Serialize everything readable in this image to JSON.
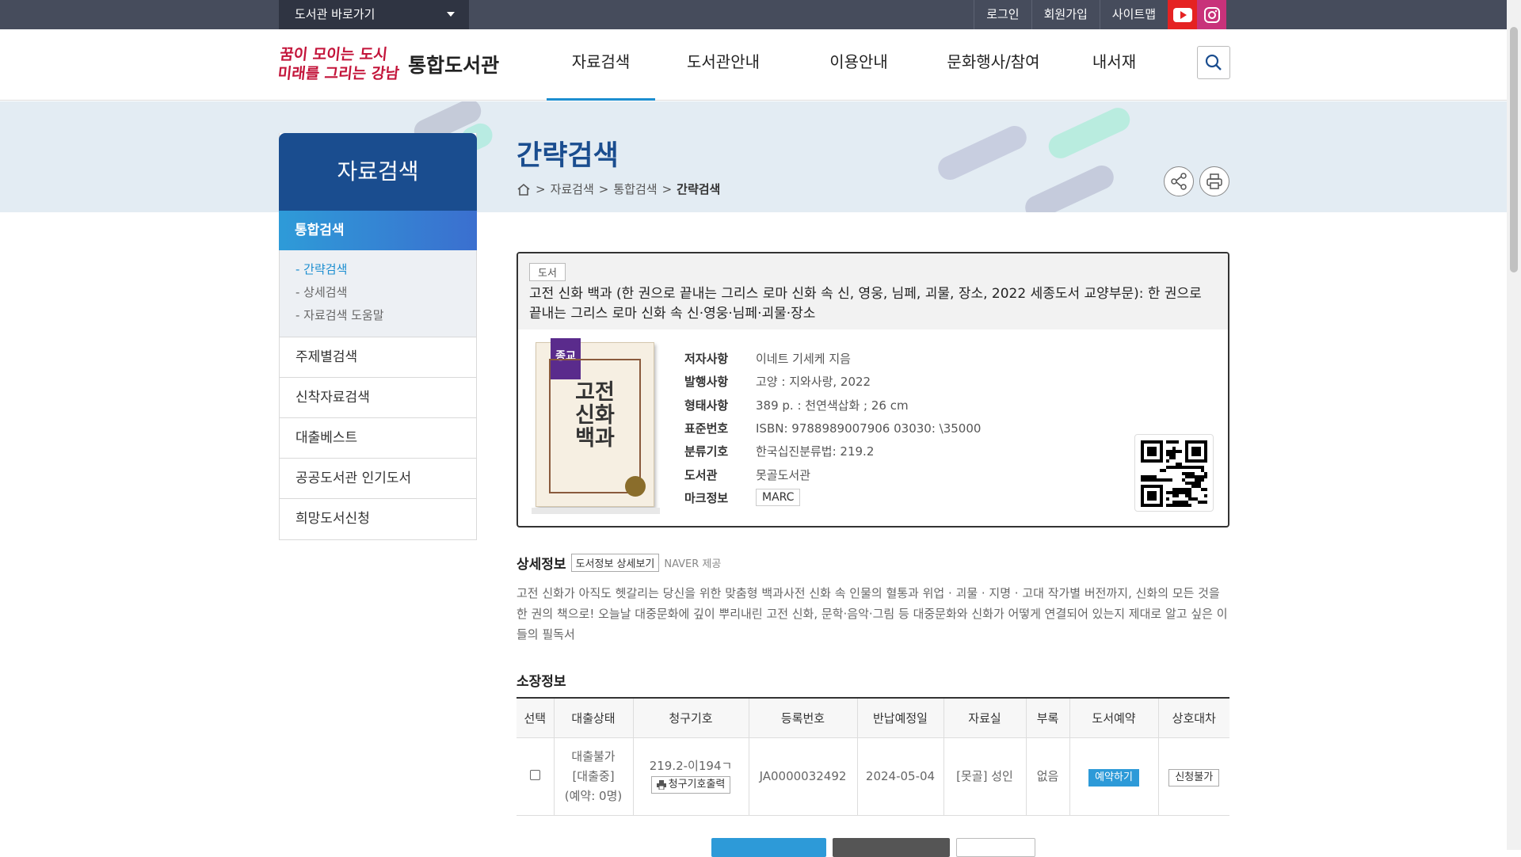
{
  "topbar": {
    "library_select": "도서관 바로가기",
    "links": [
      "로그인",
      "회원가입",
      "사이트맵"
    ]
  },
  "header": {
    "logo_line1a": "꿈이 모이는 도시",
    "logo_line1b": "미래를 그리는 강남",
    "logo_title": "통합도서관",
    "nav": [
      "자료검색",
      "도서관안내",
      "이용안내",
      "문화행사/참여",
      "내서재"
    ]
  },
  "sidebar": {
    "title": "자료검색",
    "active": "통합검색",
    "subitems": [
      "- 간략검색",
      "- 상세검색",
      "- 자료검색 도움말"
    ],
    "items": [
      "주제별검색",
      "신착자료검색",
      "대출베스트",
      "공공도서관 인기도서",
      "희망도서신청"
    ]
  },
  "page": {
    "title": "간략검색",
    "breadcrumb": [
      "자료검색",
      "통합검색",
      "간략검색"
    ]
  },
  "book": {
    "type_tag": "도서",
    "title": "고전 신화 백과 (한 권으로 끝내는 그리스 로마 신화 속 신, 영웅, 님페, 괴물, 장소, 2022 세종도서 교양부문): 한 권으로 끝내는 그리스 로마 신화 속 신·영웅·님페·괴물·장소",
    "cover": {
      "ribbon": "종교",
      "title": "고전 신화 백과"
    },
    "fields": [
      {
        "label": "저자사항",
        "value": "이네트 기세케 지음"
      },
      {
        "label": "발행사항",
        "value": "고양 : 지와사랑, 2022"
      },
      {
        "label": "형태사항",
        "value": "389 p. : 천연색삽화 ; 26 cm"
      },
      {
        "label": "표준번호",
        "value": "ISBN: 9788989007906 03030: \\35000"
      },
      {
        "label": "분류기호",
        "value": "한국십진분류법: 219.2"
      },
      {
        "label": "도서관",
        "value": "못골도서관"
      },
      {
        "label": "마크정보",
        "value": "MARC"
      }
    ]
  },
  "detail": {
    "heading": "상세정보",
    "button": "도서정보 상세보기",
    "source": "NAVER 제공",
    "description": "고전 신화가 아직도 헷갈리는 당신을 위한 맞춤형 백과사전 신화 속 인물의 혈통과 위업 · 괴물 · 지명 · 고대 작가별 버전까지, 신화의 모든 것을 한 권의 책으로! 오늘날 대중문화에 깊이 뿌리내린 고전 신화, 문학·음악·그림 등 대중문화와 신화가 어떻게 연결되어 있는지 제대로 알고 싶은 이들의 필독서"
  },
  "holdings": {
    "heading": "소장정보",
    "columns": [
      "선택",
      "대출상태",
      "청구기호",
      "등록번호",
      "반납예정일",
      "자료실",
      "부록",
      "도서예약",
      "상호대차"
    ],
    "row": {
      "status": [
        "대출불가",
        "[대출중]",
        "(예약: 0명)"
      ],
      "call_number": "219.2-이194ㄱ",
      "print_label": "청구기호출력",
      "reg_number": "JA0000032492",
      "due_date": "2024-05-04",
      "room": "[못골] 성인",
      "appendix": "없음",
      "reserve": "예약하기",
      "ill": "신청불가"
    }
  },
  "colors": {
    "accent": "#1c8ed0",
    "navy": "#1a4d8f",
    "topbar": "#464c5c"
  }
}
